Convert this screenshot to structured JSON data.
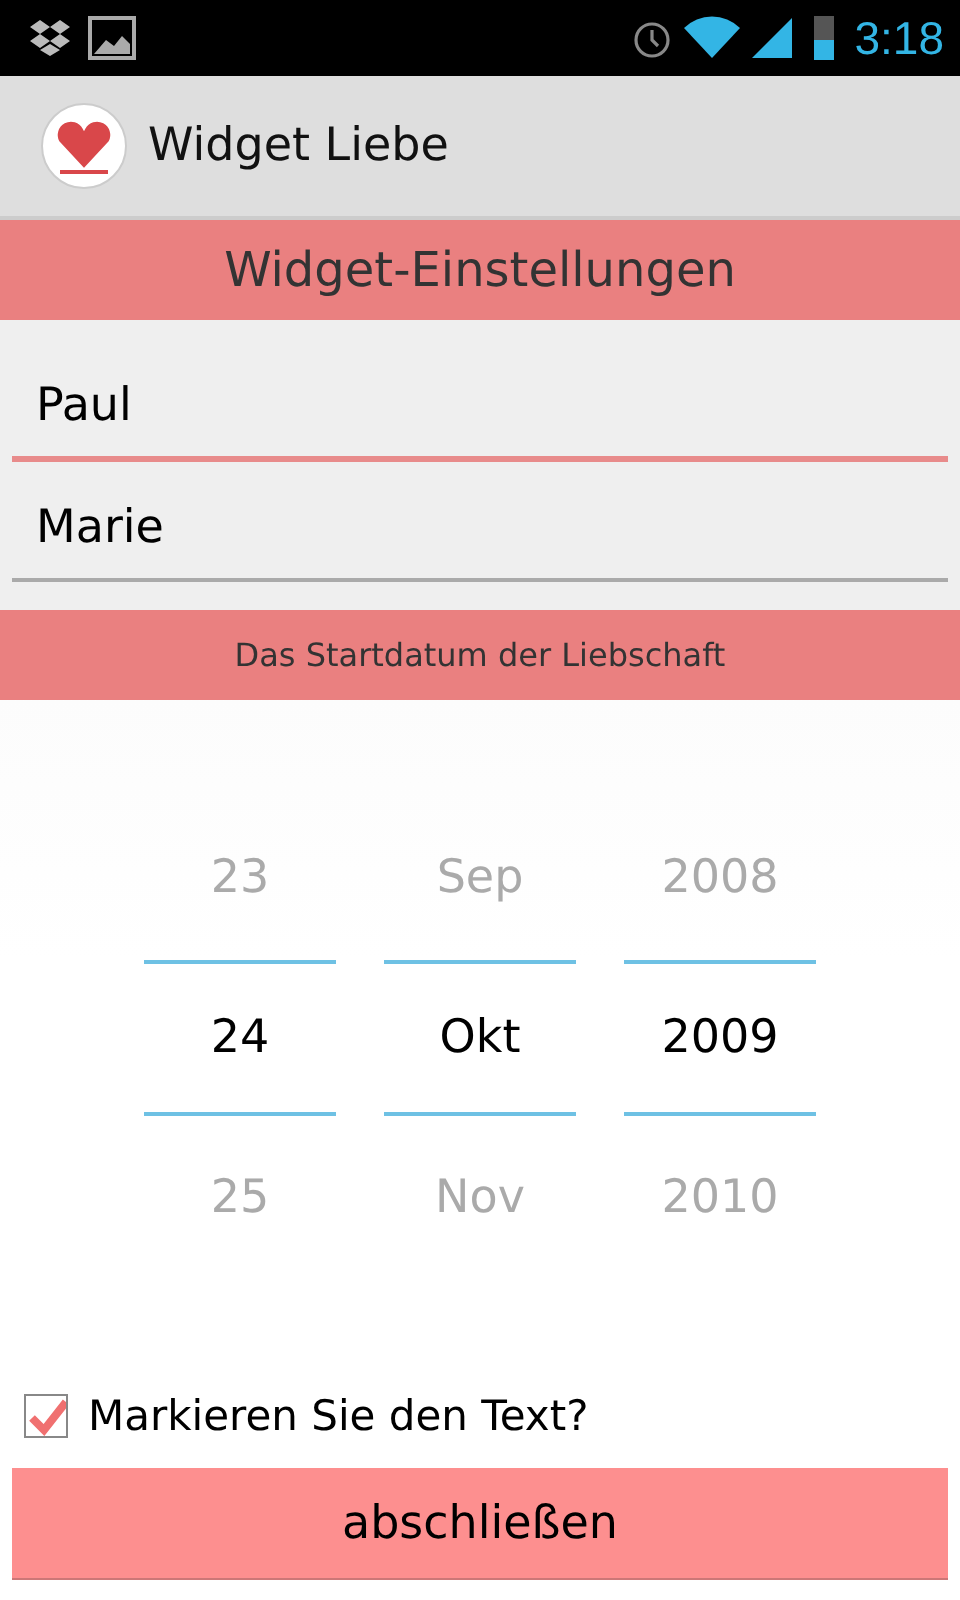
{
  "status_bar": {
    "time": "3:18"
  },
  "action_bar": {
    "title": "Widget Liebe"
  },
  "header": "Widget-Einstellungen",
  "fields": [
    {
      "value": "Paul",
      "focused": true
    },
    {
      "value": "Marie",
      "focused": false
    }
  ],
  "date_label": "Das Startdatum der Liebschaft",
  "date_picker": [
    {
      "previous": "23",
      "current": "24",
      "next": "25"
    },
    {
      "previous": "Sep",
      "current": "Okt",
      "next": "Nov"
    },
    {
      "previous": "2008",
      "current": "2009",
      "next": "2010"
    }
  ],
  "checkbox": {
    "label": "Markieren Sie den Text?",
    "checked": true
  },
  "button": "abschließen"
}
